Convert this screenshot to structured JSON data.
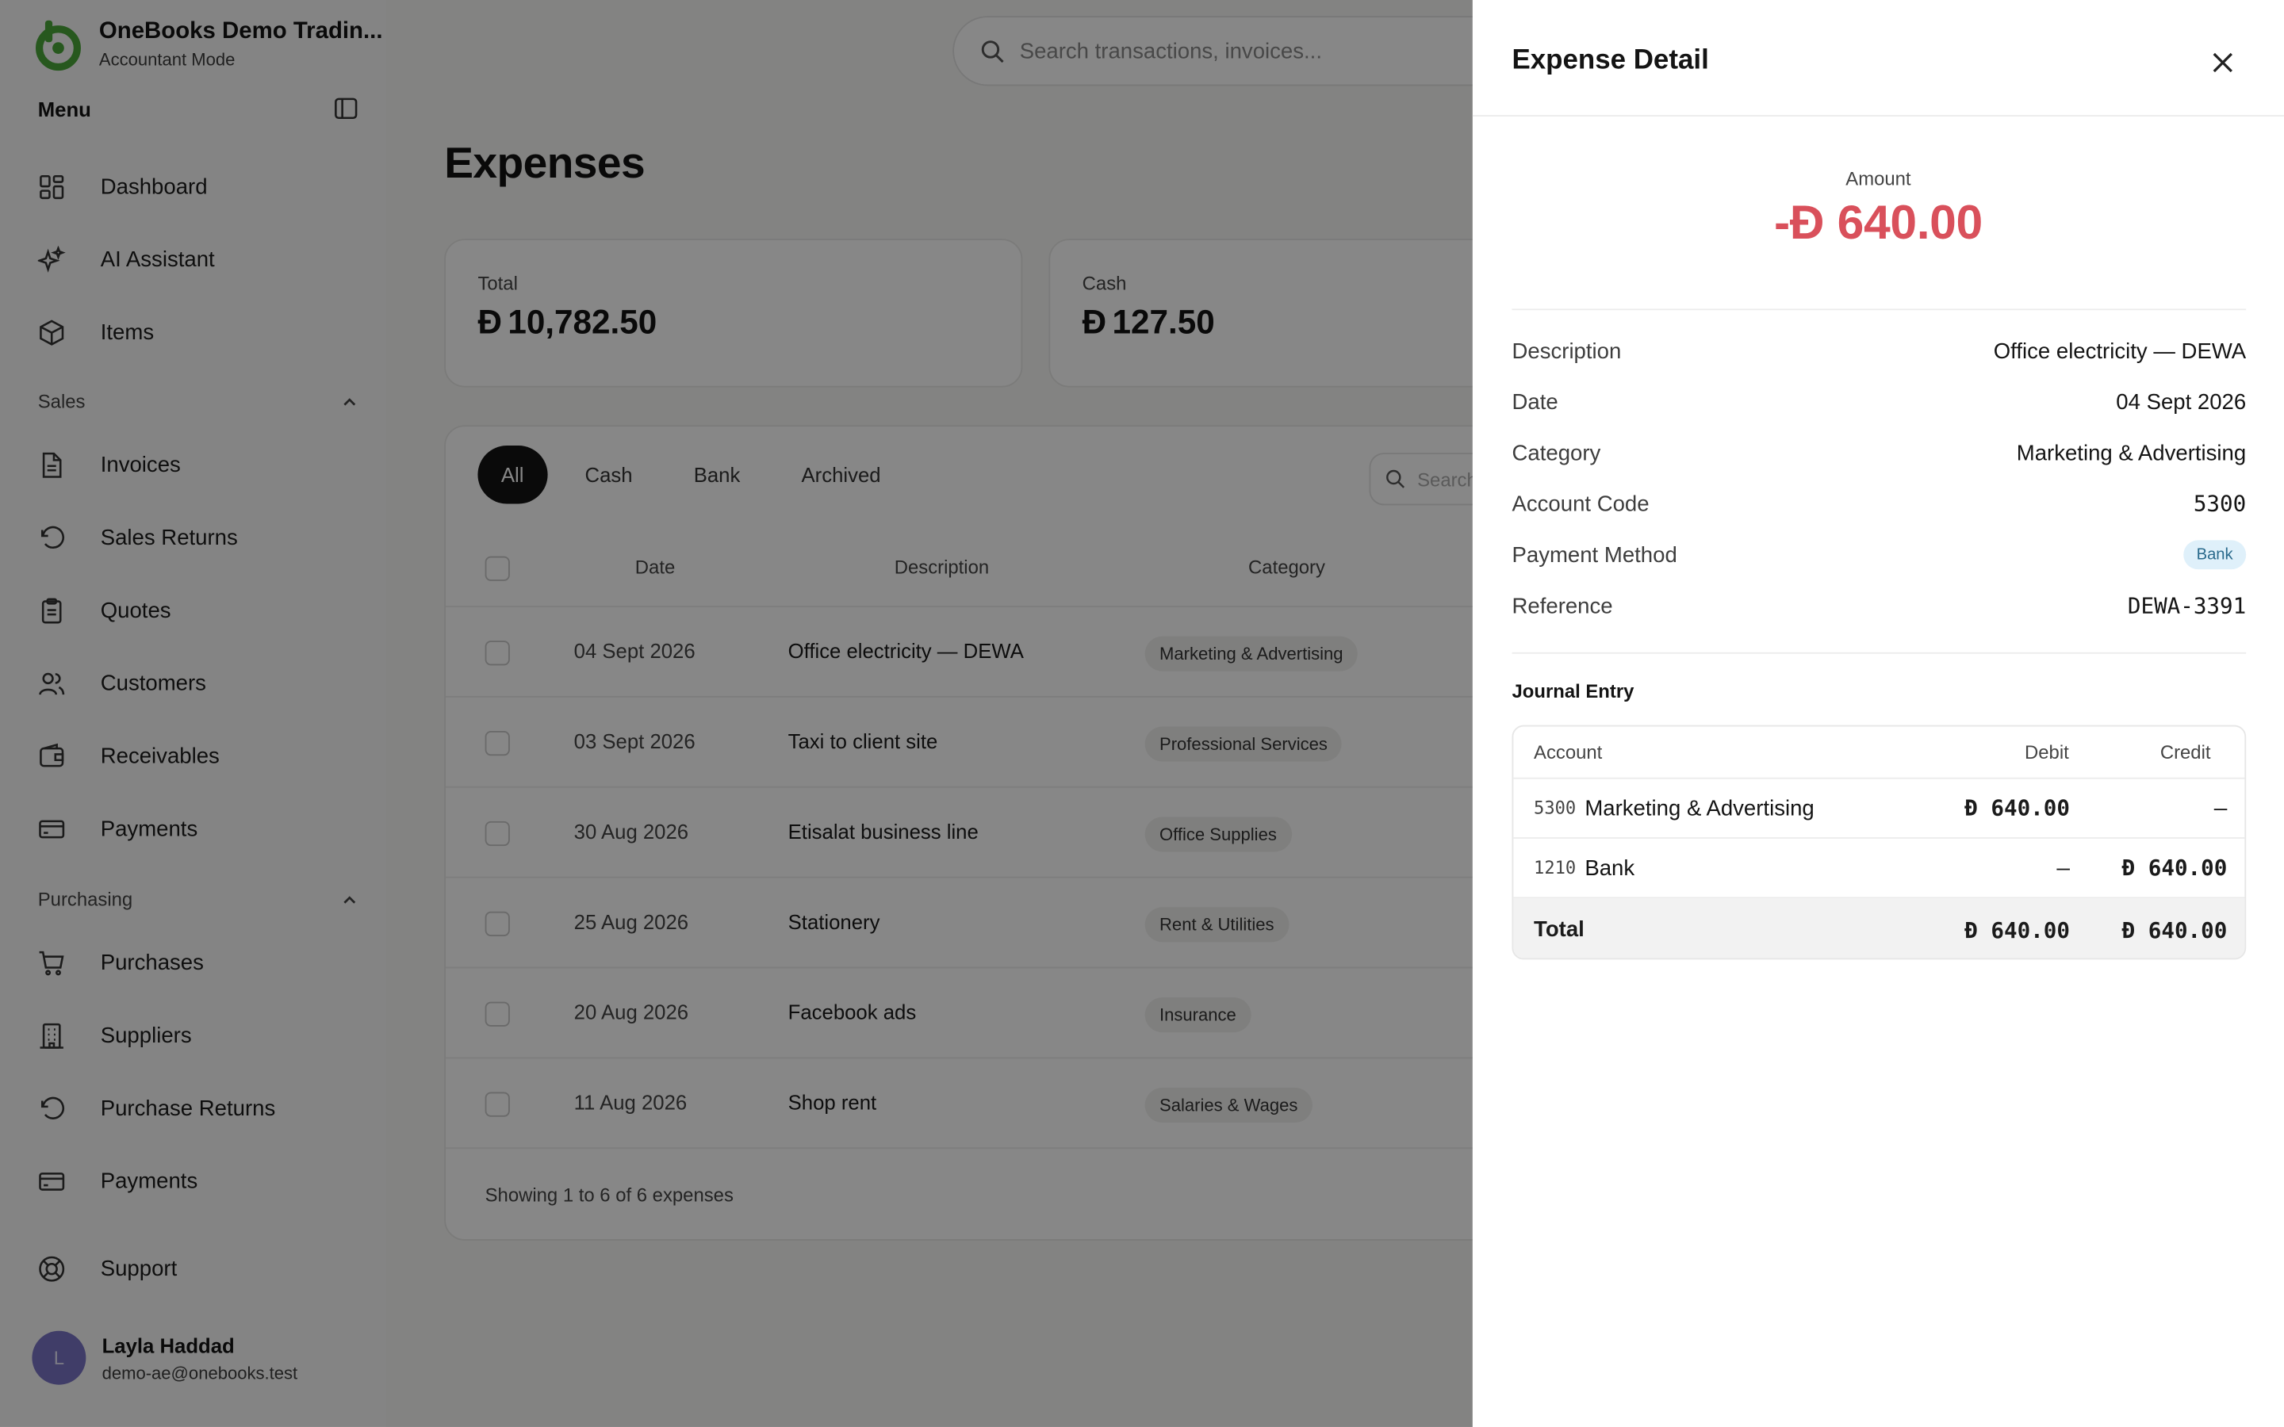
{
  "brand": {
    "name": "OneBooks Demo Tradin...",
    "subtitle": "Accountant Mode"
  },
  "sidebar": {
    "menu_title": "Menu",
    "top_items": [
      {
        "label": "Dashboard",
        "icon": "grid-icon"
      },
      {
        "label": "AI Assistant",
        "icon": "sparkles-icon"
      },
      {
        "label": "Items",
        "icon": "box-icon"
      }
    ],
    "sales_label": "Sales",
    "sales_items": [
      {
        "label": "Invoices",
        "icon": "file-icon"
      },
      {
        "label": "Sales Returns",
        "icon": "undo-icon"
      },
      {
        "label": "Quotes",
        "icon": "clipboard-icon"
      },
      {
        "label": "Customers",
        "icon": "users-icon"
      },
      {
        "label": "Receivables",
        "icon": "wallet-icon"
      },
      {
        "label": "Payments",
        "icon": "card-icon"
      }
    ],
    "purchasing_label": "Purchasing",
    "purchasing_items": [
      {
        "label": "Purchases",
        "icon": "cart-icon"
      },
      {
        "label": "Suppliers",
        "icon": "building-icon"
      },
      {
        "label": "Purchase Returns",
        "icon": "undo-icon"
      },
      {
        "label": "Payments",
        "icon": "card-icon"
      }
    ],
    "support_label": "Support",
    "user": {
      "initial": "L",
      "name": "Layla Haddad",
      "email": "demo-ae@onebooks.test"
    }
  },
  "header": {
    "search_placeholder": "Search transactions, invoices..."
  },
  "main": {
    "title": "Expenses",
    "stats": [
      {
        "label": "Total",
        "value": "10,782.50"
      },
      {
        "label": "Cash",
        "value": "127.50"
      }
    ],
    "currency_symbol": "Ð",
    "tabs": [
      "All",
      "Cash",
      "Bank",
      "Archived"
    ],
    "table_search_placeholder": "Search",
    "columns": [
      "Date",
      "Description",
      "Category"
    ],
    "rows": [
      {
        "date": "04 Sept 2026",
        "description": "Office electricity — DEWA",
        "category": "Marketing & Advertising"
      },
      {
        "date": "03 Sept 2026",
        "description": "Taxi to client site",
        "category": "Professional Services"
      },
      {
        "date": "30 Aug 2026",
        "description": "Etisalat business line",
        "category": "Office Supplies"
      },
      {
        "date": "25 Aug 2026",
        "description": "Stationery",
        "category": "Rent & Utilities"
      },
      {
        "date": "20 Aug 2026",
        "description": "Facebook ads",
        "category": "Insurance"
      },
      {
        "date": "11 Aug 2026",
        "description": "Shop rent",
        "category": "Salaries & Wages"
      }
    ],
    "footer": "Showing 1 to 6 of 6 expenses"
  },
  "drawer": {
    "title": "Expense Detail",
    "amount_label": "Amount",
    "amount_value": "-Ð 640.00",
    "fields": [
      {
        "label": "Description",
        "value": "Office electricity — DEWA"
      },
      {
        "label": "Date",
        "value": "04 Sept 2026"
      },
      {
        "label": "Category",
        "value": "Marketing & Advertising"
      },
      {
        "label": "Account Code",
        "value": "5300"
      },
      {
        "label": "Payment Method",
        "value": "Bank"
      },
      {
        "label": "Reference",
        "value": "DEWA-3391"
      }
    ],
    "journal_title": "Journal Entry",
    "journal_columns": [
      "Account",
      "Debit",
      "Credit"
    ],
    "journal_rows": [
      {
        "code": "5300",
        "name": "Marketing & Advertising",
        "debit": "Ð 640.00",
        "credit": "–"
      },
      {
        "code": "1210",
        "name": "Bank",
        "debit": "–",
        "credit": "Ð 640.00"
      }
    ],
    "journal_total": {
      "label": "Total",
      "debit": "Ð 640.00",
      "credit": "Ð 640.00"
    }
  },
  "colors": {
    "accent_green": "#4aa63a",
    "negative_red": "#d9505b",
    "badge_blue_bg": "#dff0fa"
  }
}
